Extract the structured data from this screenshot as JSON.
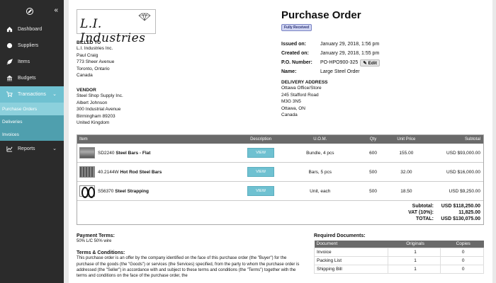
{
  "sidebar": {
    "items": [
      {
        "label": "Dashboard",
        "icon": "dashboard-icon"
      },
      {
        "label": "Suppliers",
        "icon": "globe-icon"
      },
      {
        "label": "Items",
        "icon": "rocket-icon"
      },
      {
        "label": "Budgets",
        "icon": "bank-icon"
      },
      {
        "label": "Transactions",
        "icon": "cart-icon"
      },
      {
        "label": "Reports",
        "icon": "chart-icon"
      }
    ],
    "sub_items": [
      "Purchase Orders",
      "Deliveries",
      "Invoices"
    ],
    "accent": "#6fc1d1"
  },
  "company": {
    "logo_text": "L.I. Industries"
  },
  "billed_to": {
    "label": "BILLED TO",
    "lines": [
      "L.I. Industries Inc.",
      "Paul Craig",
      "773 Sheer Avenue",
      "Toronto, Ontario",
      "Canada"
    ]
  },
  "vendor": {
    "label": "VENDOR",
    "lines": [
      "Steel Shop Supply Inc.",
      "Albert Johnson",
      "300 Industrial Avenue",
      "Birmingham 89203",
      "United Kingdom"
    ]
  },
  "po": {
    "title": "Purchase Order",
    "status": "Fully Received",
    "issued_label": "Issued on:",
    "issued": "January 29, 2018, 1:56 pm",
    "created_label": "Created on:",
    "created": "January 29, 2018, 1:55 pm",
    "number_label": "P.O. Number:",
    "number": "PO-HPO900-325",
    "edit": "Edit",
    "name_label": "Name:",
    "name": "Large Steel Order"
  },
  "delivery": {
    "label": "DELIVERY ADDRESS",
    "lines": [
      "Ottawa Office/Store",
      "245 Stafford Road",
      "M3G 3N5",
      "Ottawa, ON",
      "Canada"
    ]
  },
  "items_table": {
    "headers": [
      "Item",
      "Description",
      "U.O.M.",
      "Qty",
      "Unit Price",
      "Subtotal"
    ],
    "view_label": "VIEW",
    "rows": [
      {
        "code": "SD2240",
        "name": "Steel Bars - Flat",
        "uom": "Bundle, 4 pcs",
        "qty": "600",
        "unit_price": "155.00",
        "subtotal": "USD $93,000.00"
      },
      {
        "code": "40.2144W",
        "name": "Hot Rod Steel Bars",
        "uom": "Bars, 5 pcs",
        "qty": "500",
        "unit_price": "32.00",
        "subtotal": "USD $16,000.00"
      },
      {
        "code": "S56370",
        "name": "Steel Strapping",
        "uom": "Unit, each",
        "qty": "500",
        "unit_price": "18.50",
        "subtotal": "USD $9,250.00"
      }
    ],
    "totals": [
      {
        "label": "Subtotal:",
        "value": "USD $118,250.00"
      },
      {
        "label": "VAT (10%):",
        "value": "11,825.00"
      },
      {
        "label": "TOTAL:",
        "value": "USD $130,075.00"
      }
    ]
  },
  "payment": {
    "label": "Payment Terms:",
    "value": "50% L/C 50% wire"
  },
  "terms": {
    "label": "Terms & Conditions:",
    "text": "This purchase order is an offer by the company identified on the face of this purchase order (the \"Buyer\") for the purchase of the goods (the \"Goods\") or services (the Services) specified, from the party to whom the purchase order is addressed (the \"Seller\") in accordance with and subject to these terms and conditions (the \"Terms\") together with the terms and conditions on the face of the purchase order, the"
  },
  "required_docs": {
    "label": "Required Documents:",
    "headers": [
      "Document",
      "Originals",
      "Copies"
    ],
    "rows": [
      {
        "doc": "Invoice",
        "originals": "1",
        "copies": "0"
      },
      {
        "doc": "Packing List",
        "originals": "1",
        "copies": "0"
      },
      {
        "doc": "Shipping Bill",
        "originals": "1",
        "copies": "0"
      }
    ]
  }
}
